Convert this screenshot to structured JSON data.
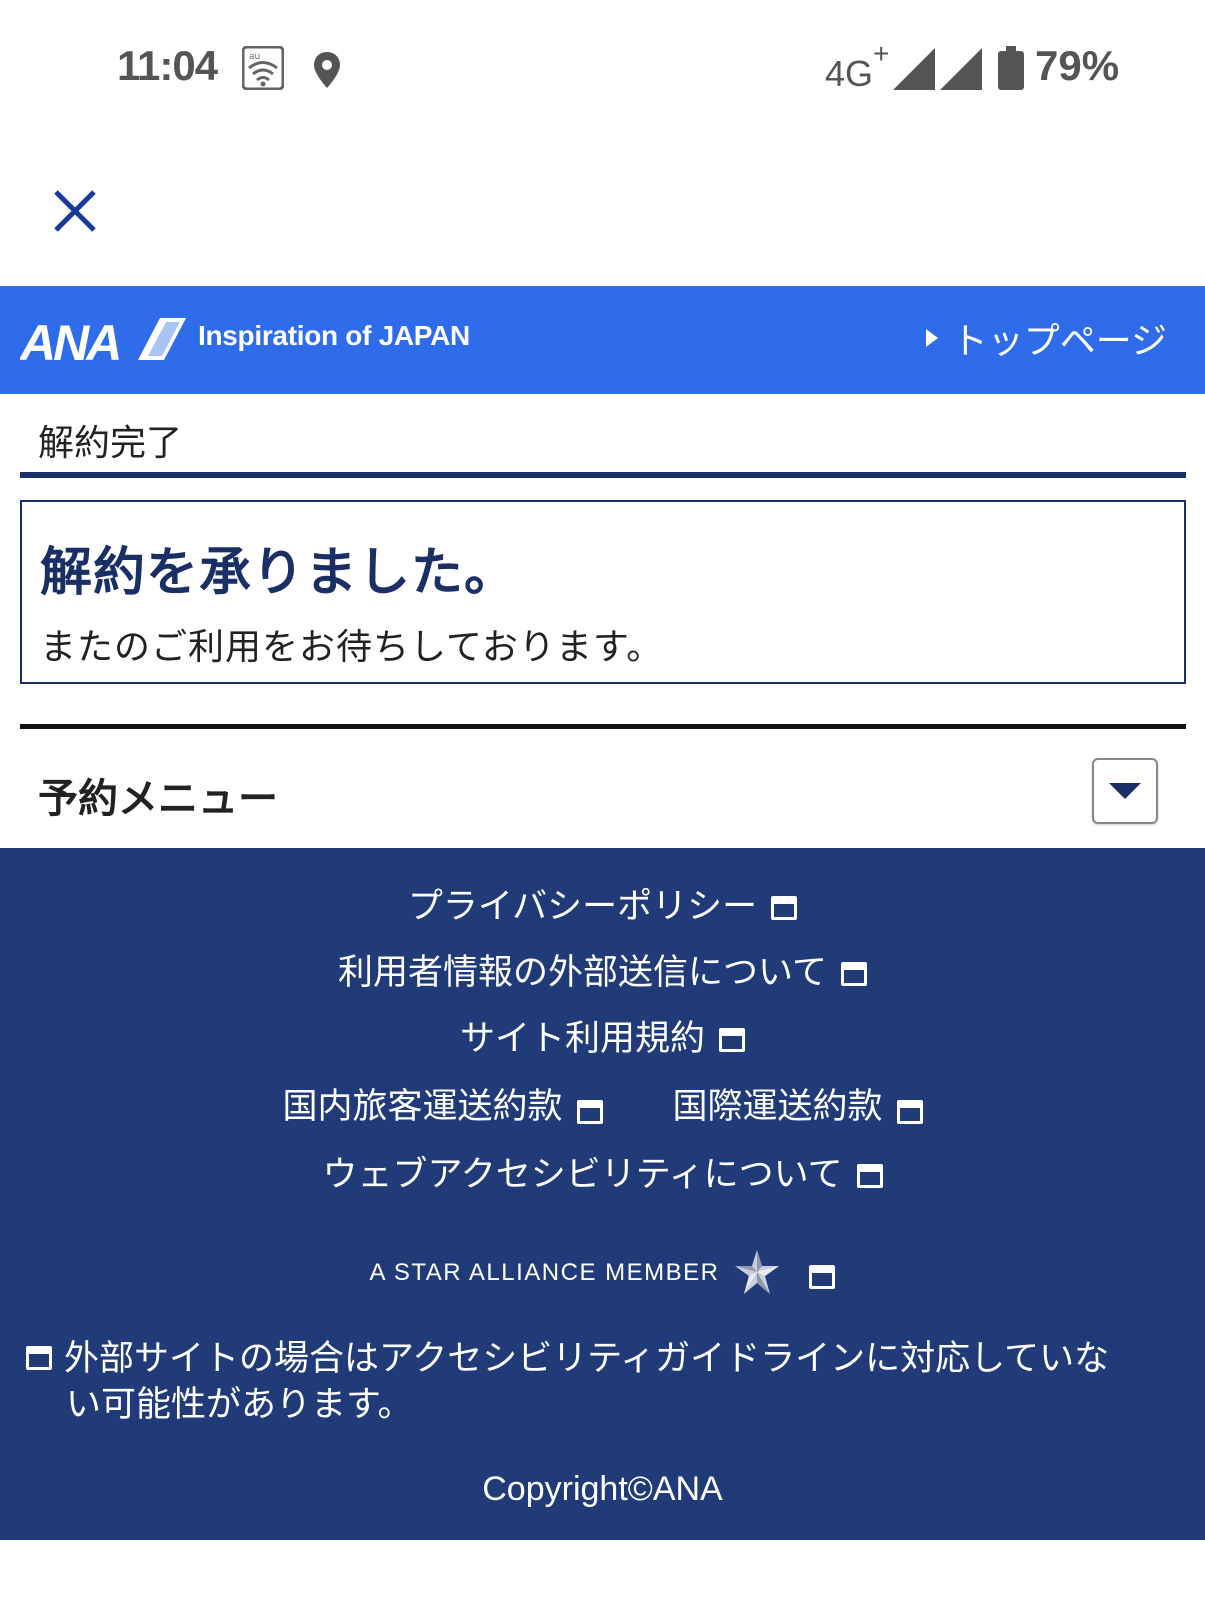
{
  "status_bar": {
    "time": "11:04",
    "network": "4G",
    "network_suffix": "+",
    "battery": "79%",
    "icons": [
      "wifi-icon",
      "location-icon",
      "signal-icon",
      "signal-icon",
      "battery-icon"
    ]
  },
  "header": {
    "logo_text": "ANA",
    "tagline": "Inspiration of JAPAN",
    "top_page_link": "トップページ",
    "color": "#2f6ce9"
  },
  "page": {
    "title": "解約完了",
    "message_heading": "解約を承りました。",
    "message_sub": "またのご利用をお待ちしております。"
  },
  "menu": {
    "title": "予約メニュー",
    "expanded": false
  },
  "footer": {
    "color": "#213b79",
    "links": {
      "privacy": "プライバシーポリシー",
      "external_send": "利用者情報の外部送信について",
      "terms": "サイト利用規約",
      "domestic": "国内旅客運送約款",
      "international": "国際運送約款",
      "accessibility": "ウェブアクセシビリティについて"
    },
    "star_alliance": "A STAR ALLIANCE MEMBER",
    "note_line1": "外部サイトの場合はアクセシビリティガイドラインに対応していな",
    "note_line2": "い可能性があります。",
    "copyright": "Copyright©ANA"
  }
}
